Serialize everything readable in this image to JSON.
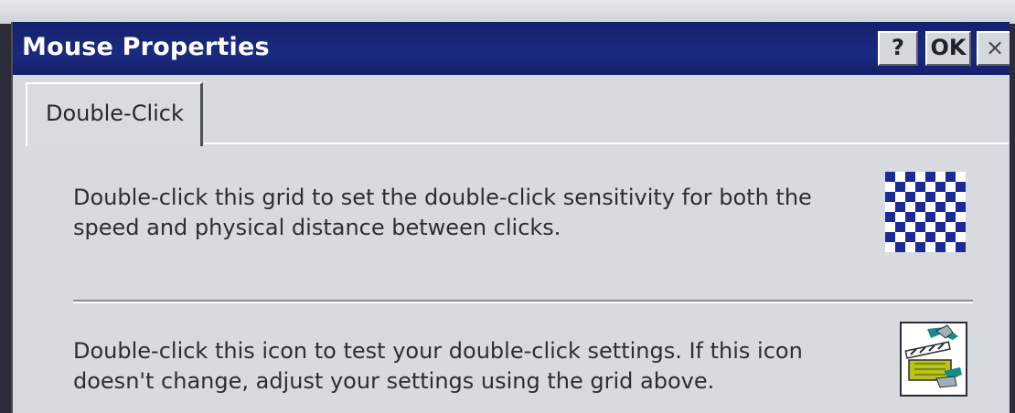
{
  "window": {
    "title": "Mouse Properties",
    "help_label": "?",
    "ok_label": "OK",
    "close_label": "×"
  },
  "tabs": [
    {
      "label": "Double-Click",
      "active": true
    }
  ],
  "double_click": {
    "grid_description": "Double-click this grid to set the double-click sensitivity for both the speed and physical distance between clicks.",
    "grid_icon": "checkerboard-grid-icon",
    "test_description": "Double-click this icon to test your double-click settings. If this icon doesn't change, adjust your settings using the grid above.",
    "test_icon": "clapperboard-icon"
  },
  "colors": {
    "titlebar": "#16216a",
    "title_text": "#ffffff",
    "window_bg": "#d7dade",
    "grid_blue": "#1b2a96"
  }
}
